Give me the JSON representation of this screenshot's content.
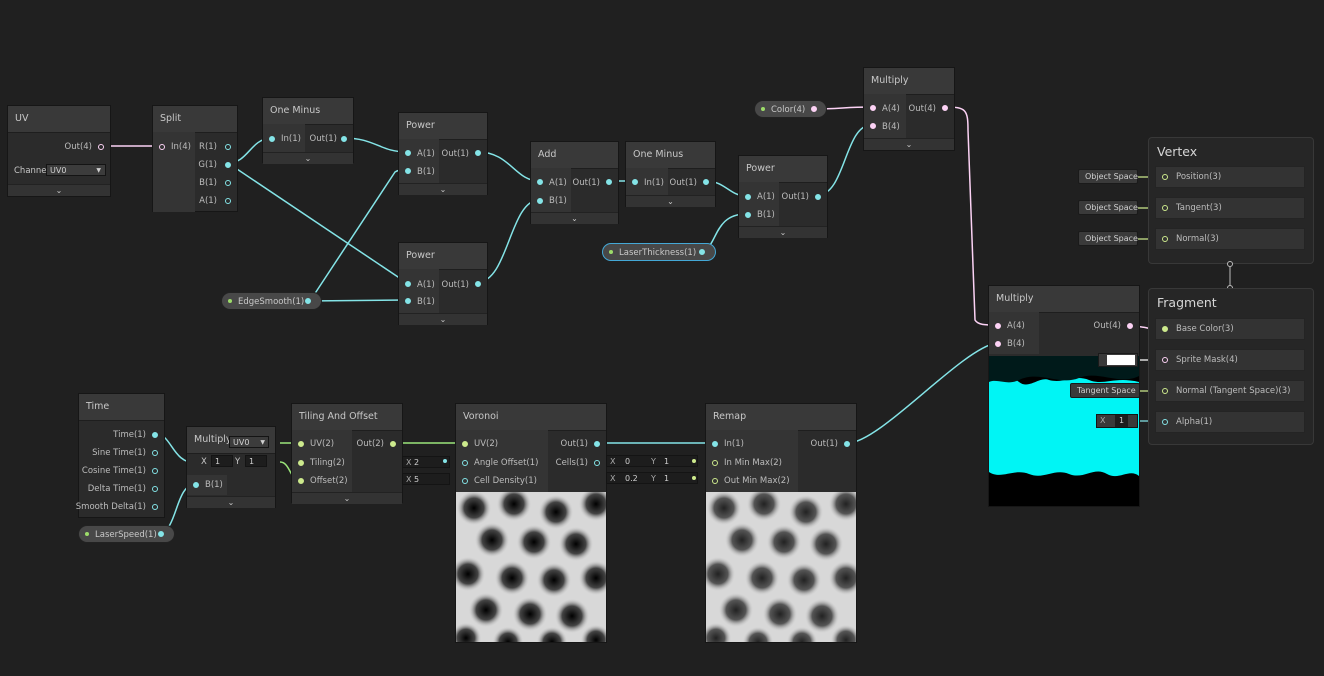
{
  "nodes": {
    "uv": {
      "title": "UV",
      "out": "Out(4)",
      "channel_label": "Channe",
      "channel_value": "UV0"
    },
    "split": {
      "title": "Split",
      "in": "In(4)",
      "outs": [
        "R(1)",
        "G(1)",
        "B(1)",
        "A(1)"
      ]
    },
    "one_minus_1": {
      "title": "One Minus",
      "in": "In(1)",
      "out": "Out(1)"
    },
    "power_1": {
      "title": "Power",
      "a": "A(1)",
      "b": "B(1)",
      "out": "Out(1)"
    },
    "power_2": {
      "title": "Power",
      "a": "A(1)",
      "b": "B(1)",
      "out": "Out(1)"
    },
    "add": {
      "title": "Add",
      "a": "A(1)",
      "b": "B(1)",
      "out": "Out(1)"
    },
    "one_minus_2": {
      "title": "One Minus",
      "in": "In(1)",
      "out": "Out(1)"
    },
    "power_3": {
      "title": "Power",
      "a": "A(1)",
      "b": "B(1)",
      "out": "Out(1)"
    },
    "multiply_top": {
      "title": "Multiply",
      "a": "A(4)",
      "b": "B(4)",
      "out": "Out(4)"
    },
    "multiply_right": {
      "title": "Multiply",
      "a": "A(4)",
      "b": "B(4)",
      "out": "Out(4)"
    },
    "time": {
      "title": "Time",
      "outs": [
        "Time(1)",
        "Sine Time(1)",
        "Cosine Time(1)",
        "Delta Time(1)",
        "Smooth Delta(1)"
      ]
    },
    "multiply_time": {
      "title": "Multiply",
      "b": "B(1)",
      "uv_select": "UV0",
      "x_label": "X",
      "x_value": "1",
      "y_label": "Y",
      "y_value": "1"
    },
    "tiling": {
      "title": "Tiling And Offset",
      "ins": [
        "UV(2)",
        "Tiling(2)",
        "Offset(2)"
      ],
      "out": "Out(2)"
    },
    "voronoi": {
      "title": "Voronoi",
      "ins": [
        "UV(2)",
        "Angle Offset(1)",
        "Cell Density(1)"
      ],
      "outs": [
        "Out(1)",
        "Cells(1)"
      ],
      "angle_value": "2",
      "density_value": "5"
    },
    "remap": {
      "title": "Remap",
      "ins": [
        "In(1)",
        "In Min Max(2)",
        "Out Min Max(2)"
      ],
      "out": "Out(1)",
      "in_x": "0",
      "in_y": "1",
      "out_x": "0.2",
      "out_y": "1",
      "x_label": "X",
      "y_label": "Y"
    }
  },
  "properties": {
    "color": "Color(4)",
    "laser_thickness": "LaserThickness(1)",
    "edge_smooth": "EdgeSmooth(1)",
    "laser_speed": "LaserSpeed(1)"
  },
  "master": {
    "vertex": {
      "title": "Vertex",
      "slots": [
        {
          "chip": "Object Space",
          "label": "Position(3)"
        },
        {
          "chip": "Object Space",
          "label": "Tangent(3)"
        },
        {
          "chip": "Object Space",
          "label": "Normal(3)"
        }
      ]
    },
    "fragment": {
      "title": "Fragment",
      "slots": [
        {
          "chip": "",
          "label": "Base Color(3)"
        },
        {
          "chip": "",
          "label": "Sprite Mask(4)"
        },
        {
          "chip": "Tangent Space",
          "label": "Normal (Tangent Space)(3)"
        },
        {
          "chip": "X  1",
          "label": "Alpha(1)"
        }
      ]
    },
    "alpha_x_label": "X",
    "alpha_value": "1"
  },
  "colors": {
    "background": "#202020",
    "vector1_wire": "#84e4e7",
    "vector4_wire": "#fcd2f5",
    "vector2_wire": "#9be67a",
    "preview_cyan": "#00f5f5"
  },
  "icons": [
    "dropdown-arrow-icon",
    "expand-chevron-icon",
    "port-dot-icon",
    "property-dot-icon"
  ]
}
